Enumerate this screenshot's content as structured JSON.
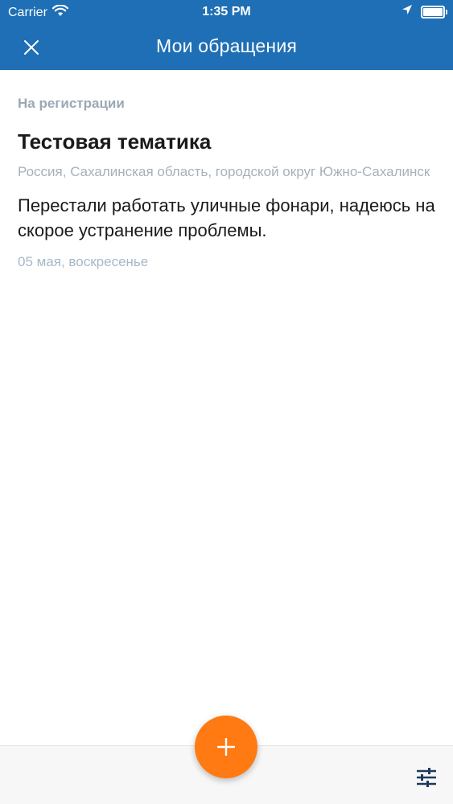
{
  "status_bar": {
    "carrier": "Carrier",
    "time": "1:35 PM",
    "battery_level": 1.0
  },
  "nav": {
    "title": "Мои обращения"
  },
  "appeals": [
    {
      "status": "На регистрации",
      "topic": "Тестовая тематика",
      "address": "Россия, Сахалинская область, городской округ Южно-Сахалинск",
      "text": "Перестали работать уличные фонари, надеюсь на скорое устранение проблемы.",
      "date": "05 мая, воскресенье"
    }
  ],
  "colors": {
    "accent": "#1e6fb5",
    "fab": "#ff7a12",
    "muted": "#a6b1bb"
  },
  "icons": {
    "close": "close-icon",
    "add": "plus-icon",
    "filter": "sliders-icon",
    "wifi": "wifi-icon",
    "location": "location-arrow-icon",
    "battery": "battery-icon"
  }
}
